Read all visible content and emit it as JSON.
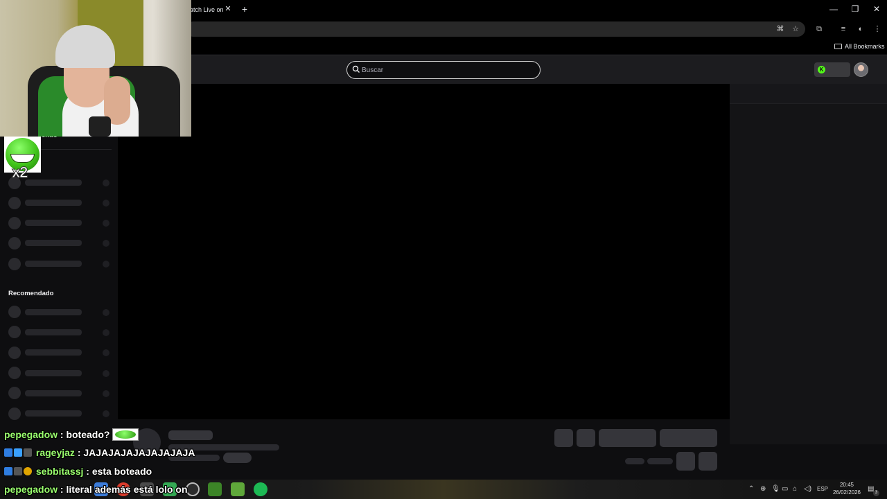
{
  "browser": {
    "tab_title": "atch Live on",
    "tab_close": "✕",
    "new_tab": "+",
    "window": {
      "minimize": "—",
      "restore": "❐",
      "close": "✕"
    },
    "bookmarks_bar": {
      "all_bookmarks": "All Bookmarks"
    }
  },
  "site": {
    "search": {
      "placeholder": "Buscar"
    },
    "sidebar": {
      "section_following_partial": "endo",
      "section_recommended": "Recomendado"
    }
  },
  "overlay": {
    "emote_multiplier": "x2",
    "chat": [
      {
        "user": "pepegadow",
        "message": ": boteado?",
        "has_emote": true
      },
      {
        "user": "rageyjaz",
        "message": ": JAJAJAJAJAJAJAJAJA",
        "has_emote": false
      },
      {
        "user": "sebbitassj",
        "message": ": esta boteado",
        "has_emote": false
      },
      {
        "user": "pepegadow",
        "message": ": literal además está lolo on",
        "has_emote": false
      }
    ]
  },
  "taskbar": {
    "language": "ESP",
    "time": "20:45",
    "date": "26/02/2026",
    "notification_count": "3"
  },
  "colors": {
    "kick_green": "#53fc18",
    "background": "#0e0e10",
    "chat_username": "#9aff6e"
  }
}
